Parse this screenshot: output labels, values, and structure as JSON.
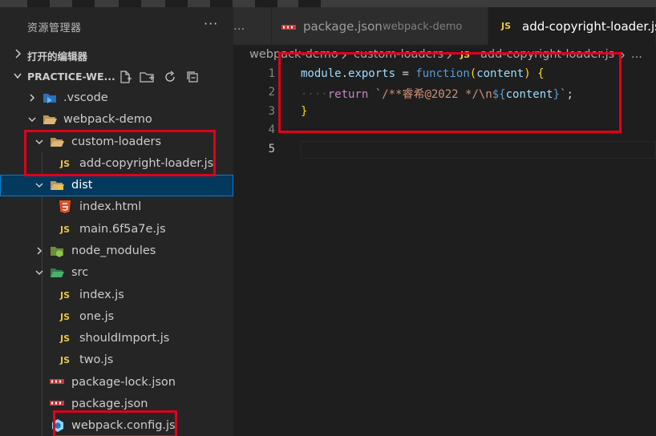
{
  "explorer": {
    "title": "资源管理器",
    "more": "···",
    "open_editors_label": "打开的编辑器",
    "workspace_label": "PRACTICE-WE..."
  },
  "tree": [
    {
      "label": ".vscode",
      "icon": "vscode-folder-icon"
    },
    {
      "label": "webpack-demo",
      "icon": "folder-open-icon"
    },
    {
      "label": "custom-loaders",
      "icon": "folder-open-icon"
    },
    {
      "label": "add-copyright-loader.js",
      "icon": "js-file-icon"
    },
    {
      "label": "dist",
      "icon": "dist-folder-icon"
    },
    {
      "label": "index.html",
      "icon": "html5-file-icon"
    },
    {
      "label": "main.6f5a7e.js",
      "icon": "js-file-icon"
    },
    {
      "label": "node_modules",
      "icon": "node-folder-icon"
    },
    {
      "label": "src",
      "icon": "src-folder-icon"
    },
    {
      "label": "index.js",
      "icon": "js-file-icon"
    },
    {
      "label": "one.js",
      "icon": "js-file-icon"
    },
    {
      "label": "shouldImport.js",
      "icon": "js-file-icon"
    },
    {
      "label": "two.js",
      "icon": "js-file-icon"
    },
    {
      "label": "package-lock.json",
      "icon": "npm-file-icon"
    },
    {
      "label": "package.json",
      "icon": "npm-file-icon"
    },
    {
      "label": "webpack.config.js",
      "icon": "webpack-file-icon"
    }
  ],
  "js_badge": "JS",
  "tabs": [
    {
      "label": "...",
      "icon": ""
    },
    {
      "label": "package.json",
      "desc": "webpack-demo",
      "icon": "npm-file-icon"
    },
    {
      "label": "add-copyright-loader.js",
      "icon": "js-file-icon"
    }
  ],
  "breadcrumb": [
    "webpack-demo",
    "custom-loaders",
    "add-copyright-loader.js",
    "..."
  ],
  "code": {
    "line_numbers": [
      "1",
      "2",
      "3",
      "4",
      "5"
    ],
    "l1": [
      "module",
      ".",
      "exports",
      " = ",
      "function",
      "(",
      "content",
      ")",
      " {"
    ],
    "l2": [
      "····",
      "return",
      " `/**睿希@2022 */\\n",
      "${",
      "content",
      "}",
      "`",
      ";"
    ],
    "l3": [
      "}"
    ]
  },
  "colors": {
    "highlight": "#e0001b",
    "selection": "#04395e",
    "js_yellow": "#e8c547"
  }
}
